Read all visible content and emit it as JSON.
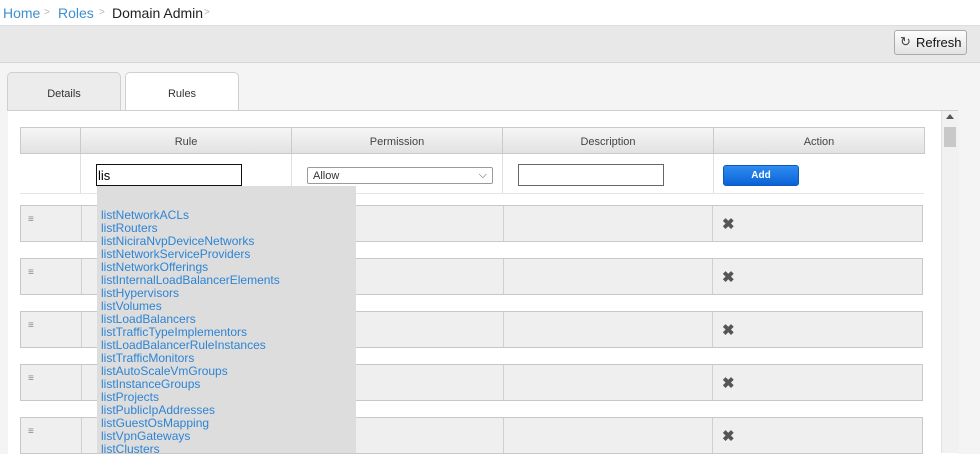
{
  "breadcrumb": {
    "home": "Home",
    "roles": "Roles",
    "current": "Domain Admin",
    "sep": ">"
  },
  "toolbar": {
    "refresh_label": "Refresh"
  },
  "tabs": [
    {
      "label": "Details"
    },
    {
      "label": "Rules"
    }
  ],
  "table": {
    "columns": [
      "Rule",
      "Permission",
      "Description",
      "Action"
    ],
    "new_rule": {
      "rule_value": "lis",
      "permission_value": "Allow",
      "description_value": "",
      "add_label": "Add"
    }
  },
  "autocomplete": [
    "listNetworkACLs",
    "listRouters",
    "listNiciraNvpDeviceNetworks",
    "listNetworkServiceProviders",
    "listNetworkOfferings",
    "listInternalLoadBalancerElements",
    "listHypervisors",
    "listVolumes",
    "listLoadBalancers",
    "listTrafficTypeImplementors",
    "listLoadBalancerRuleInstances",
    "listTrafficMonitors",
    "listAutoScaleVmGroups",
    "listInstanceGroups",
    "listProjects",
    "listPublicIpAddresses",
    "listGuestOsMapping",
    "listVpnGateways",
    "listClusters"
  ],
  "icons": {
    "refresh": "refresh-icon",
    "drag": "drag-handle-icon",
    "delete": "delete-icon",
    "chevron": "chevron-down-icon"
  }
}
